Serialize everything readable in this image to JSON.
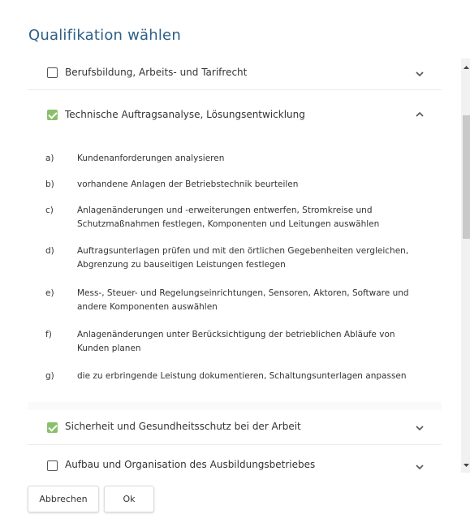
{
  "dialog": {
    "title": "Qualifikation wählen"
  },
  "sections": [
    {
      "label": "Berufsbildung, Arbeits- und Tarifrecht",
      "checked": false,
      "expanded": false
    },
    {
      "label": "Technische Auftragsanalyse, Lösungsentwicklung",
      "checked": true,
      "expanded": true,
      "items": [
        {
          "key": "a)",
          "text": "Kundenanforderungen analysieren"
        },
        {
          "key": "b)",
          "text": "vorhandene Anlagen der Betriebstechnik beurteilen"
        },
        {
          "key": "c)",
          "text": "Anlagenänderungen und -erweiterungen entwerfen, Stromkreise und Schutzmaßnahmen festlegen, Komponenten und Leitungen auswählen"
        },
        {
          "key": "d)",
          "text": "Auftragsunterlagen prüfen und mit den örtlichen Gegebenheiten vergleichen, Abgrenzung zu bauseitigen Leistungen festlegen"
        },
        {
          "key": "e)",
          "text": "Mess-, Steuer- und Regelungseinrichtungen, Sensoren, Aktoren, Software und andere Komponenten auswählen"
        },
        {
          "key": "f)",
          "text": "Anlagenänderungen unter Berücksichtigung der betrieblichen Abläufe von Kunden planen"
        },
        {
          "key": "g)",
          "text": "die zu erbringende Leistung dokumentieren, Schaltungsunterlagen anpassen"
        }
      ]
    },
    {
      "label": "Sicherheit und Gesundheitsschutz bei der Arbeit",
      "checked": true,
      "expanded": false
    },
    {
      "label": "Aufbau und Organisation des Ausbildungsbetriebes",
      "checked": false,
      "expanded": false
    }
  ],
  "buttons": {
    "cancel": "Abbrechen",
    "ok": "Ok"
  },
  "colors": {
    "title": "#2d5f86",
    "checkbox_checked": "#8ac06a"
  }
}
